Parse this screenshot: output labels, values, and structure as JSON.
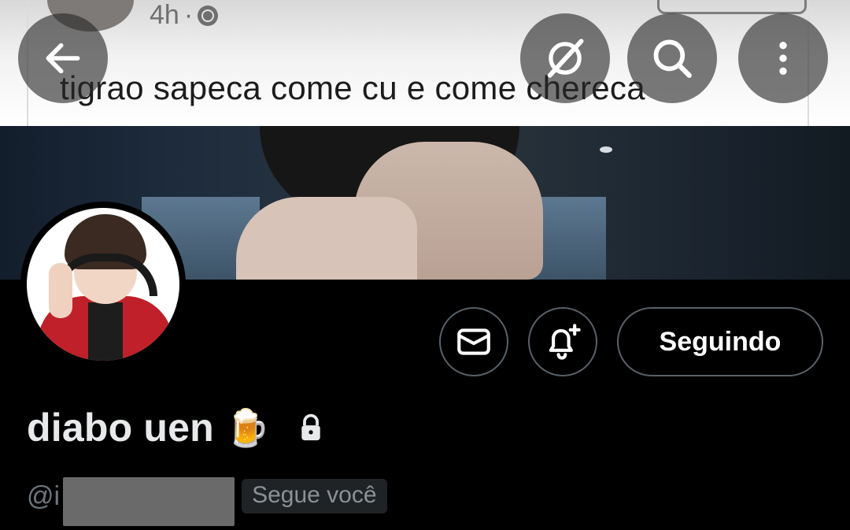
{
  "banner": {
    "post": {
      "time": "4h",
      "separator": "·",
      "text": "tigrao sapeca come cu e come chereca"
    }
  },
  "nav": {
    "back_icon": "arrow-left-icon",
    "grok_icon": "grok-icon",
    "search_icon": "search-icon",
    "more_icon": "more-vertical-icon"
  },
  "actions": {
    "message_icon": "mail-icon",
    "notify_icon": "bell-plus-icon",
    "follow_label": "Seguindo"
  },
  "profile": {
    "display_name": "diabo uen",
    "emoji": "🍺",
    "protected_icon": "lock-icon",
    "handle_prefix": "@i",
    "follows_you": "Segue você"
  },
  "colors": {
    "background": "#000000",
    "primary_text": "#e7e9ea",
    "secondary_text": "#6e767d",
    "border": "#596168"
  }
}
